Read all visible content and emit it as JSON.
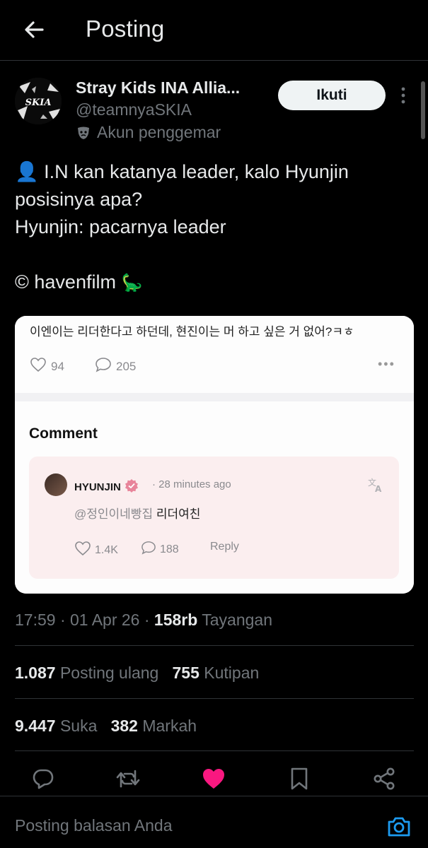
{
  "header": {
    "title": "Posting"
  },
  "author": {
    "name": "Stray Kids INA Allia...",
    "handle": "@teamnyaSKIA",
    "badge": "Akun penggemar",
    "avatar_text": "SKIA",
    "follow_label": "Ikuti"
  },
  "post": {
    "line1": "👤 I.N kan katanya leader, kalo Hyunjin",
    "line2": "posisinya apa?",
    "line3": "Hyunjin: pacarnya leader",
    "line5": "© havenfilm",
    "emoji": "🦕"
  },
  "embedded": {
    "post_text": "이엔이는 리더한다고 하던데, 현진이는 머 하고 싶은 거 없어?ㅋㅎ",
    "likes": "94",
    "comments": "205",
    "comment_heading": "Comment",
    "comment": {
      "author": "HYUNJIN",
      "time": "· 28 minutes ago",
      "mention": "@정인이네빵집",
      "text": "리더여친",
      "likes": "1.4K",
      "replies": "188",
      "reply_label": "Reply"
    }
  },
  "meta": {
    "time": "17:59 · 01 Apr 26 ·",
    "views": "158rb",
    "views_label": "Tayangan"
  },
  "stats": {
    "reposts": "1.087",
    "reposts_label": "Posting ulang",
    "quotes": "755",
    "quotes_label": "Kutipan",
    "likes": "9.447",
    "likes_label": "Suka",
    "bookmarks": "382",
    "bookmarks_label": "Markah"
  },
  "reply": {
    "placeholder": "Posting balasan Anda"
  },
  "colors": {
    "accent": "#1d9bf0",
    "like": "#f91880",
    "verified": "#e8849a"
  },
  "icons": [
    "back-arrow-icon",
    "more-vertical-icon",
    "mask-icon",
    "reply-icon",
    "repost-icon",
    "heart-icon",
    "bookmark-icon",
    "share-icon",
    "camera-icon",
    "translate-icon",
    "verified-icon"
  ]
}
